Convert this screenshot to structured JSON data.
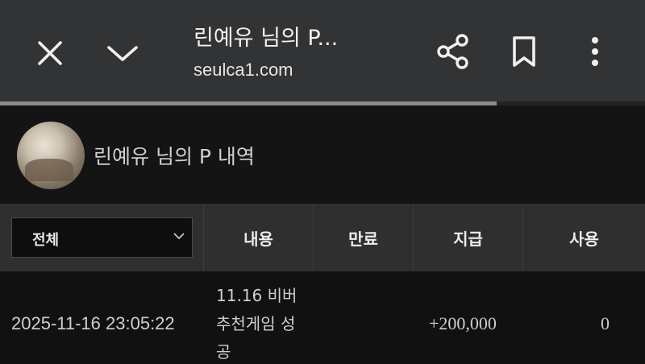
{
  "browser": {
    "tab_title": "린예유 님의 P...",
    "url": "seulca1.com",
    "progress": 0.77
  },
  "icons": {
    "close": "close-icon",
    "chevron_down": "chevron-down-icon",
    "share": "share-icon",
    "bookmark": "bookmark-icon",
    "more": "more-vertical-icon"
  },
  "profile": {
    "title": "린예유 님의 P 내역"
  },
  "table": {
    "filter": {
      "selected": "전체"
    },
    "columns": [
      "내용",
      "만료",
      "지급",
      "사용"
    ],
    "rows": [
      {
        "date": "2025-11-16 23:05:22",
        "content": "11.16 비버 추천게임 성공",
        "expire": "",
        "pay": "+200,000",
        "use": "0"
      }
    ]
  },
  "colors": {
    "topbar": "#323335",
    "background": "#111111",
    "header": "#2f2f2f"
  }
}
